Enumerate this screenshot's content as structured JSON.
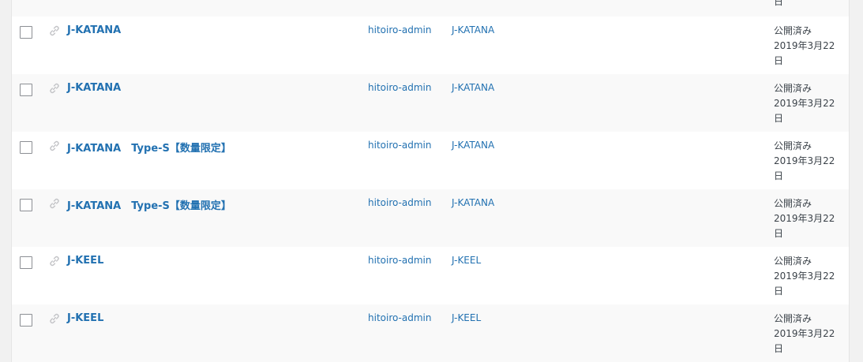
{
  "top_fragment": {
    "date_tail": "日"
  },
  "rows": [
    {
      "title": "J-KATANA",
      "author": "hitoiro-admin",
      "category": "J-KATANA",
      "status": "公開済み",
      "date_line1": "2019年3月22",
      "date_line2": "日"
    },
    {
      "title": "J-KATANA",
      "author": "hitoiro-admin",
      "category": "J-KATANA",
      "status": "公開済み",
      "date_line1": "2019年3月22",
      "date_line2": "日"
    },
    {
      "title": "J-KATANA　Type-S【数量限定】",
      "author": "hitoiro-admin",
      "category": "J-KATANA",
      "status": "公開済み",
      "date_line1": "2019年3月22",
      "date_line2": "日"
    },
    {
      "title": "J-KATANA　Type-S【数量限定】",
      "author": "hitoiro-admin",
      "category": "J-KATANA",
      "status": "公開済み",
      "date_line1": "2019年3月22",
      "date_line2": "日"
    },
    {
      "title": "J-KEEL",
      "author": "hitoiro-admin",
      "category": "J-KEEL",
      "status": "公開済み",
      "date_line1": "2019年3月22",
      "date_line2": "日"
    },
    {
      "title": "J-KEEL",
      "author": "hitoiro-admin",
      "category": "J-KEEL",
      "status": "公開済み",
      "date_line1": "2019年3月22",
      "date_line2": "日"
    }
  ],
  "icons": {
    "link": "link-icon"
  },
  "colors": {
    "link": "#2271b1",
    "text": "#3c434a",
    "row_alt": "#f9f9f9"
  }
}
